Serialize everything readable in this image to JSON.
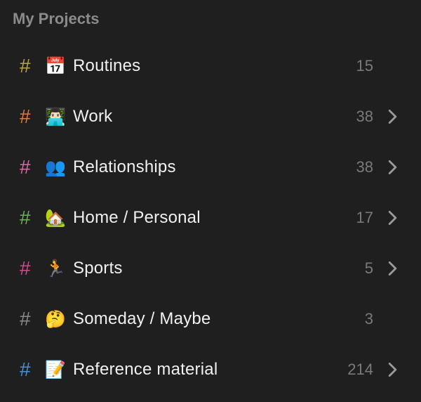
{
  "section_title": "My Projects",
  "projects": [
    {
      "hash_color": "#b8a44a",
      "emoji": "📅",
      "label": "Routines",
      "count": "15",
      "expandable": false
    },
    {
      "hash_color": "#d97b3e",
      "emoji": "👨🏻‍💻",
      "label": "Work",
      "count": "38",
      "expandable": true
    },
    {
      "hash_color": "#d36ba6",
      "emoji": "👥",
      "label": "Relationships",
      "count": "38",
      "expandable": true
    },
    {
      "hash_color": "#6fae5e",
      "emoji": "🏡",
      "label": "Home / Personal",
      "count": "17",
      "expandable": true
    },
    {
      "hash_color": "#c94f8b",
      "emoji": "🏃",
      "label": "Sports",
      "count": "5",
      "expandable": true
    },
    {
      "hash_color": "#8a8a8a",
      "emoji": "🤔",
      "label": "Someday / Maybe",
      "count": "3",
      "expandable": false
    },
    {
      "hash_color": "#4a8fd1",
      "emoji": "📝",
      "label": "Reference material",
      "count": "214",
      "expandable": true
    }
  ]
}
